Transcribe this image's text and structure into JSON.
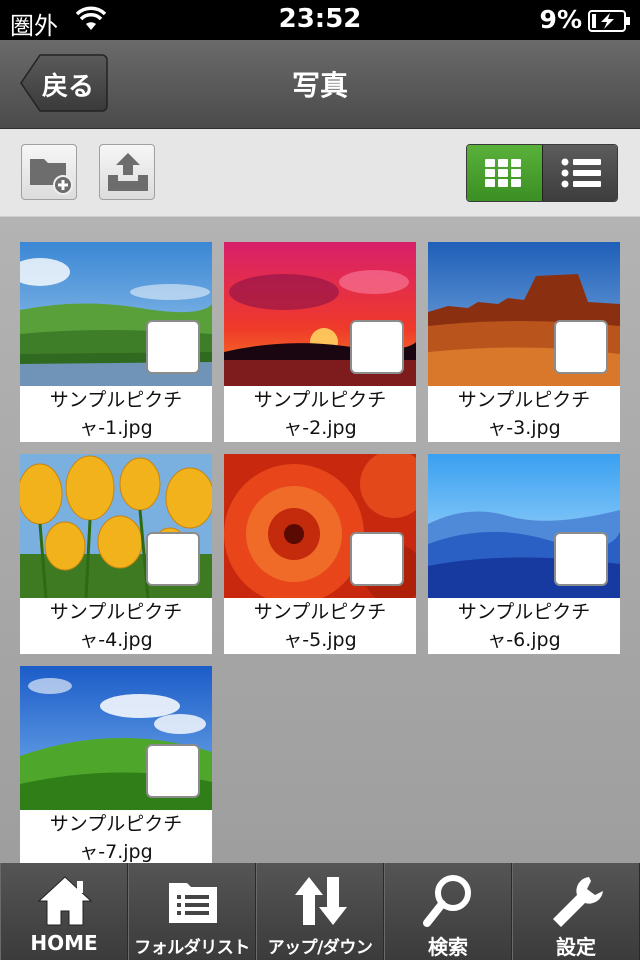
{
  "status_bar": {
    "carrier": "圏外",
    "time": "23:52",
    "battery_percent": "9%",
    "battery_level": 0.09
  },
  "nav": {
    "back_label": "戻る",
    "title": "写真"
  },
  "toolbar": {
    "icons": [
      "new-folder-icon",
      "upload-icon"
    ],
    "view_modes": [
      "grid",
      "list"
    ],
    "selected_view": "grid",
    "accent_color": "#4aa52e"
  },
  "photos": [
    {
      "name_line1": "サンプルピクチ",
      "name_line2": "ャ-1.jpg",
      "checked": false
    },
    {
      "name_line1": "サンプルピクチ",
      "name_line2": "ャ-2.jpg",
      "checked": false
    },
    {
      "name_line1": "サンプルピクチ",
      "name_line2": "ャ-3.jpg",
      "checked": false
    },
    {
      "name_line1": "サンプルピクチ",
      "name_line2": "ャ-4.jpg",
      "checked": false
    },
    {
      "name_line1": "サンプルピクチ",
      "name_line2": "ャ-5.jpg",
      "checked": false
    },
    {
      "name_line1": "サンプルピクチ",
      "name_line2": "ャ-6.jpg",
      "checked": false
    },
    {
      "name_line1": "サンプルピクチ",
      "name_line2": "ャ-7.jpg",
      "checked": false
    }
  ],
  "tabs": [
    {
      "label": "HOME",
      "icon": "home-icon"
    },
    {
      "label": "フォルダリスト",
      "icon": "folder-list-icon"
    },
    {
      "label": "アップ/ダウン",
      "icon": "up-down-arrows-icon"
    },
    {
      "label": "検索",
      "icon": "search-icon"
    },
    {
      "label": "設定",
      "icon": "wrench-icon"
    }
  ]
}
